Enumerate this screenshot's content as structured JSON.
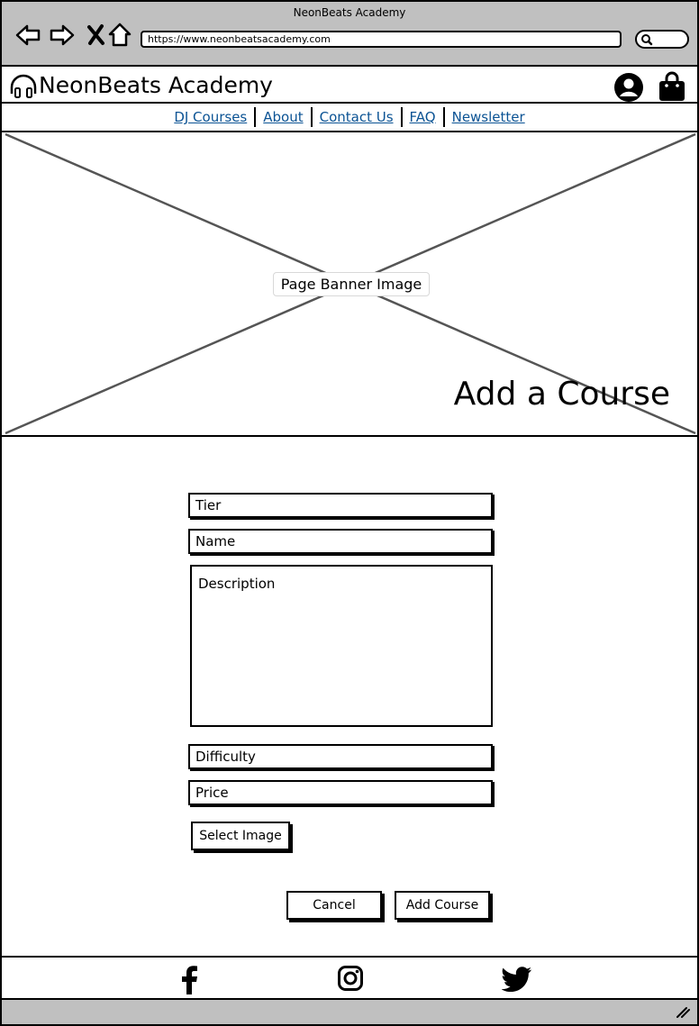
{
  "browser": {
    "window_title": "NeonBeats Academy",
    "url": "https://www.neonbeatsacademy.com"
  },
  "header": {
    "brand": "NeonBeats Academy"
  },
  "nav": {
    "items": [
      "DJ Courses",
      "About",
      "Contact Us",
      "FAQ",
      "Newsletter"
    ]
  },
  "banner": {
    "image_label": "Page Banner Image",
    "heading": "Add a Course"
  },
  "form": {
    "tier_placeholder": "Tier",
    "name_placeholder": "Name",
    "description_placeholder": "Description",
    "difficulty_placeholder": "Difficulty",
    "price_placeholder": "Price",
    "select_image_label": "Select Image",
    "cancel_label": "Cancel",
    "submit_label": "Add Course"
  },
  "footer": {
    "icons": [
      "facebook-icon",
      "instagram-icon",
      "twitter-icon"
    ]
  },
  "colors": {
    "chrome": "#c0c0c0",
    "link": "#0b5394"
  }
}
